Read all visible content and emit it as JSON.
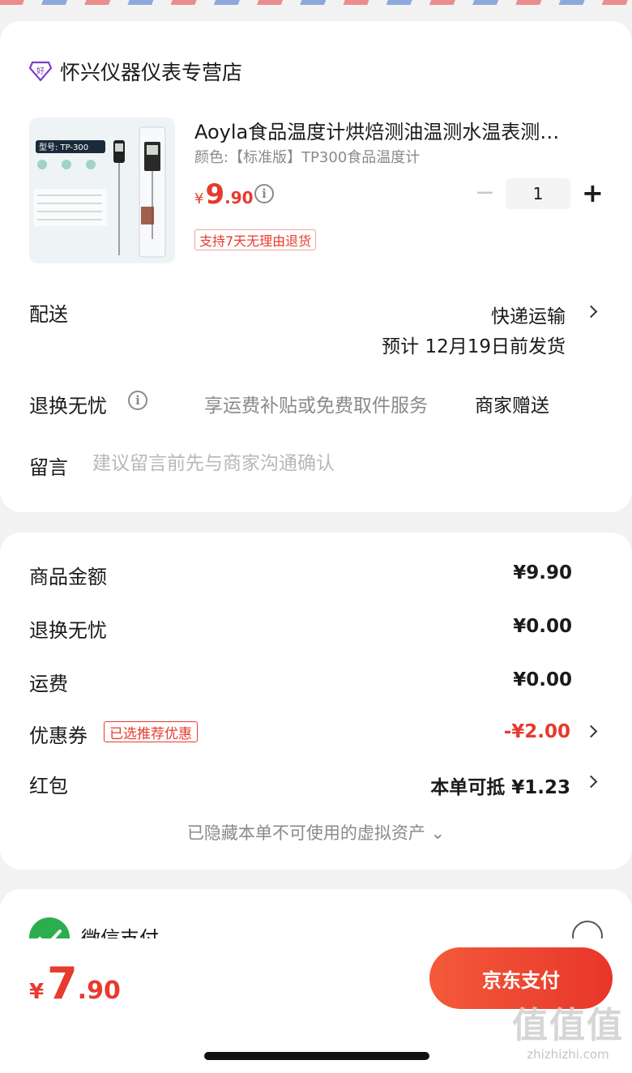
{
  "store": {
    "name": "怀兴仪器仪表专营店",
    "badge": "好"
  },
  "product": {
    "title": "Aoyla食品温度计烘焙测油温测水温表测…",
    "variant": "颜色:【标准版】TP300食品温度计",
    "price_symbol": "¥",
    "price_int": "9",
    "price_dec": ".90",
    "quantity": "1",
    "minus": "−",
    "plus": "+",
    "return_tag": "支持7天无理由退货",
    "image_model_label": "型号: TP-300"
  },
  "delivery": {
    "label": "配送",
    "method": "快递运输",
    "estimate": "预计 12月19日前发货"
  },
  "refund_worry": {
    "label": "退换无忧",
    "desc": "享运费补贴或免费取件服务",
    "gift": "商家赠送"
  },
  "message": {
    "label": "留言",
    "placeholder": "建议留言前先与商家沟通确认"
  },
  "summary": {
    "goods_label": "商品金额",
    "goods_value": "¥9.90",
    "refund_label": "退换无忧",
    "refund_value": "¥0.00",
    "shipping_label": "运费",
    "shipping_value": "¥0.00",
    "coupon_label": "优惠券",
    "coupon_tag": "已选推荐优惠",
    "coupon_value": "-¥2.00",
    "redpacket_label": "红包",
    "redpacket_value": "本单可抵 ¥1.23",
    "hidden_assets": "已隐藏本单不可使用的虚拟资产 ⌄"
  },
  "payment": {
    "wechat_label": "微信支付"
  },
  "footer": {
    "total_symbol": "¥",
    "total_int": "7",
    "total_dec": ".90",
    "pay_button": "京东支付"
  },
  "watermark": {
    "big": "值值值",
    "small": "zhizhizhi.com"
  },
  "colors": {
    "accent": "#e63b2e",
    "wechat": "#2bae4e"
  }
}
